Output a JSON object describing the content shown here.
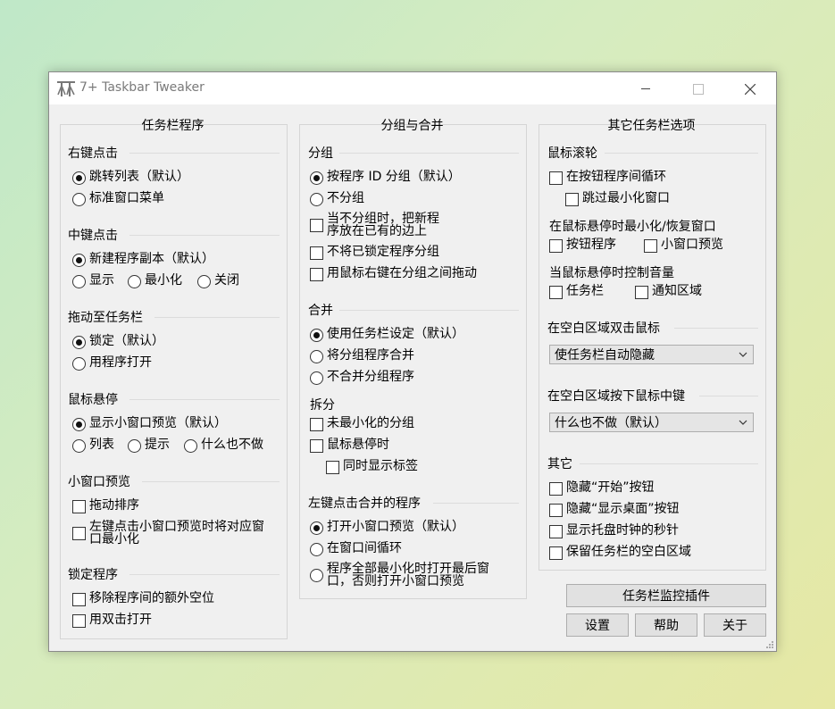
{
  "window": {
    "title": "7+ Taskbar Tweaker",
    "controls": {
      "minimize": "minimize-icon",
      "maximize": "maximize-icon",
      "close": "close-icon"
    }
  },
  "col1": {
    "title": "任务栏程序",
    "rightclick": {
      "heading": "右键点击",
      "opt1": "跳转列表（默认）",
      "opt2": "标准窗口菜单"
    },
    "middleclick": {
      "heading": "中键点击",
      "opt1": "新建程序副本（默认）",
      "opt2": "显示",
      "opt3": "最小化",
      "opt4": "关闭"
    },
    "drag": {
      "heading": "拖动至任务栏",
      "opt1": "锁定（默认）",
      "opt2": "用程序打开"
    },
    "hover": {
      "heading": "鼠标悬停",
      "opt1": "显示小窗口预览（默认）",
      "opt2": "列表",
      "opt3": "提示",
      "opt4": "什么也不做"
    },
    "thumb": {
      "heading": "小窗口预览",
      "opt1": "拖动排序",
      "opt2_line1": "左键点击小窗口预览时将对应窗",
      "opt2_line2": "口最小化"
    },
    "pinned": {
      "heading": "锁定程序",
      "opt1": "移除程序间的额外空位",
      "opt2": "用双击打开"
    }
  },
  "col2": {
    "title": "分组与合并",
    "grouping": {
      "heading": "分组",
      "opt1": "按程序 ID 分组（默认）",
      "opt2": "不分组",
      "opt3_line1": "当不分组时，把新程",
      "opt3_line2": "序放在已有的边上",
      "opt4": "不将已锁定程序分组",
      "opt5": "用鼠标右键在分组之间拖动"
    },
    "combining": {
      "heading": "合并",
      "opt1": "使用任务栏设定（默认）",
      "opt2": "将分组程序合并",
      "opt3": "不合并分组程序"
    },
    "splitting": {
      "heading": "拆分",
      "opt1": "未最小化的分组",
      "opt2": "鼠标悬停时",
      "opt3": "同时显示标签"
    },
    "leftclick": {
      "heading": "左键点击合并的程序",
      "opt1": "打开小窗口预览（默认）",
      "opt2": "在窗口间循环",
      "opt3_line1": "程序全部最小化时打开最后窗",
      "opt3_line2": "口，否则打开小窗口预览"
    }
  },
  "col3": {
    "title": "其它任务栏选项",
    "wheel": {
      "heading": "鼠标滚轮",
      "opt1": "在按钮程序间循环",
      "opt2": "跳过最小化窗口",
      "sub1": "在鼠标悬停时最小化/恢复窗口",
      "opt3": "按钮程序",
      "opt4": "小窗口预览",
      "sub2": "当鼠标悬停时控制音量",
      "opt5": "任务栏",
      "opt6": "通知区域"
    },
    "dblclick": {
      "heading": "在空白区域双击鼠标",
      "value": "使任务栏自动隐藏"
    },
    "midclick": {
      "heading": "在空白区域按下鼠标中键",
      "value": "什么也不做（默认）"
    },
    "other": {
      "heading": "其它",
      "opt1": "隐藏“开始”按钮",
      "opt2": "隐藏“显示桌面”按钮",
      "opt3": "显示托盘时钟的秒针",
      "opt4": "保留任务栏的空白区域"
    }
  },
  "buttons": {
    "inspector": "任务栏监控插件",
    "settings": "设置",
    "help": "帮助",
    "about": "关于"
  }
}
